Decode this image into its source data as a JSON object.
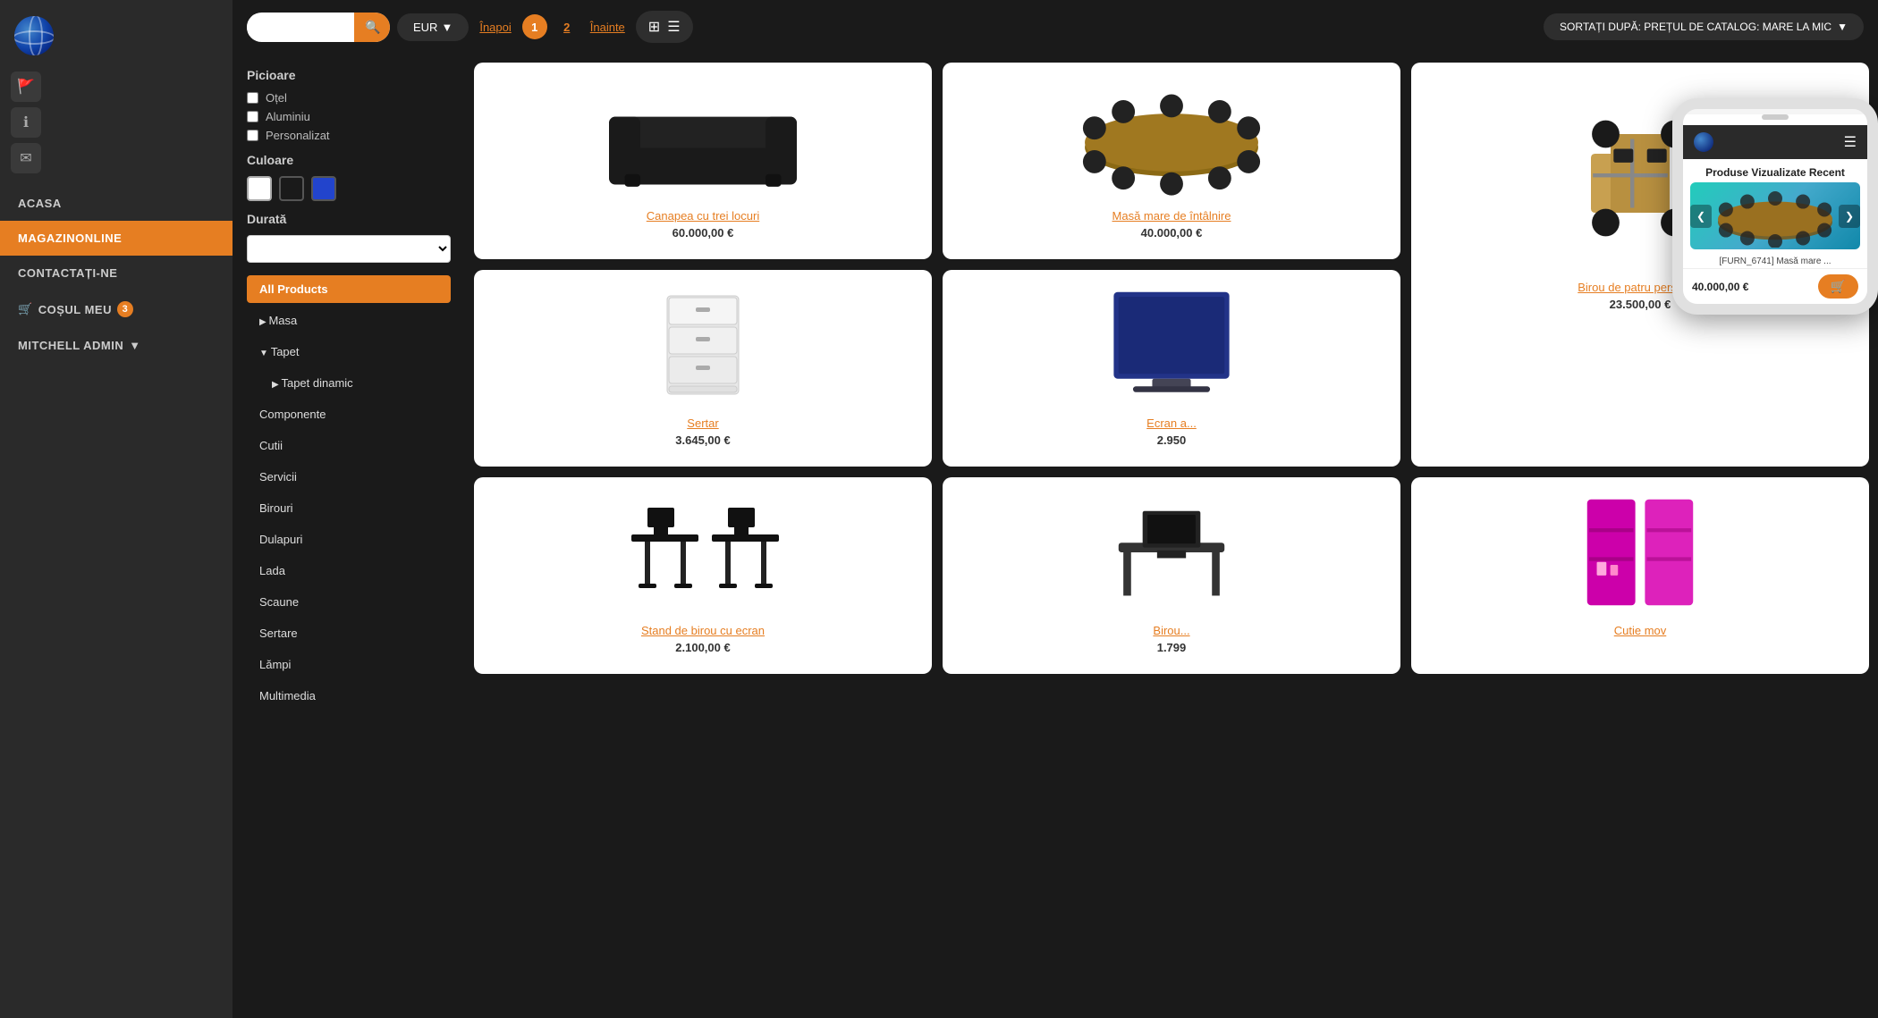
{
  "sidebar": {
    "logo_alt": "Globe Logo",
    "nav_items": [
      {
        "id": "acasa",
        "label": "ACASA",
        "active": false
      },
      {
        "id": "magazin",
        "label": "MAGAZINONLINE",
        "active": true
      },
      {
        "id": "contact",
        "label": "CONTACTAȚI-NE",
        "active": false
      },
      {
        "id": "cos",
        "label": "COȘUL MEU",
        "active": false,
        "cart": true,
        "badge": "3"
      },
      {
        "id": "admin",
        "label": "MITCHELL ADMIN",
        "active": false,
        "admin": true
      }
    ]
  },
  "toolbar": {
    "search_placeholder": "",
    "search_icon": "🔍",
    "currency_label": "EUR",
    "currency_arrow": "▼",
    "nav_back": "Înapoi",
    "page1": "1",
    "page2": "2",
    "nav_forward": "Înainte",
    "view_grid_icon": "⊞",
    "view_list_icon": "☰",
    "sort_label": "SORTAȚI DUPĂ: PREȚUL DE CATALOG: MARE LA MIC",
    "sort_arrow": "▼"
  },
  "filters": {
    "picioare_title": "Picioare",
    "picioare_options": [
      "Oțel",
      "Aluminiu",
      "Personalizat"
    ],
    "culoare_title": "Culoare",
    "colors": [
      {
        "name": "white",
        "hex": "#ffffff"
      },
      {
        "name": "black",
        "hex": "#1a1a1a"
      },
      {
        "name": "blue",
        "hex": "#2244cc"
      }
    ],
    "durata_title": "Durată",
    "durata_placeholder": "",
    "categories": [
      {
        "id": "all",
        "label": "All Products",
        "active": true
      },
      {
        "id": "masa",
        "label": "Masa",
        "arrow": "right"
      },
      {
        "id": "tapet",
        "label": "Tapet",
        "arrow": "down"
      },
      {
        "id": "tapet-dinamic",
        "label": "Tapet dinamic",
        "arrow": "right",
        "sub": true
      },
      {
        "id": "componente",
        "label": "Componente"
      },
      {
        "id": "cutii",
        "label": "Cutii"
      },
      {
        "id": "servicii",
        "label": "Servicii"
      },
      {
        "id": "birouri",
        "label": "Birouri"
      },
      {
        "id": "dulapuri",
        "label": "Dulapuri"
      },
      {
        "id": "lada",
        "label": "Lada"
      },
      {
        "id": "scaune",
        "label": "Scaune"
      },
      {
        "id": "sertare",
        "label": "Sertare"
      },
      {
        "id": "lampi",
        "label": "Lămpi"
      },
      {
        "id": "multimedia",
        "label": "Multimedia"
      }
    ]
  },
  "products": [
    {
      "id": "canapea",
      "name": "Canapea cu trei locuri",
      "price": "60.000,00 €",
      "color": "#222",
      "shape": "sofa"
    },
    {
      "id": "masa-intalnire",
      "name": "Masă mare de întâlnire",
      "price": "40.000,00 €",
      "color": "#8B6914",
      "shape": "conference-table"
    },
    {
      "id": "birou-4",
      "name": "Birou de patru persoane",
      "price": "23.500,00 €",
      "color": "#8B6914",
      "shape": "office-cluster"
    },
    {
      "id": "sertar",
      "name": "Sertar",
      "price": "3.645,00 €",
      "color": "#eee",
      "shape": "drawer"
    },
    {
      "id": "ecran",
      "name": "Ecran a...",
      "price": "2.950",
      "color": "#223388",
      "shape": "screen"
    },
    {
      "id": "stand-birou",
      "name": "Stand de birou cu ecran",
      "price": "2.100,00 €",
      "color": "#111",
      "shape": "standing-desk"
    },
    {
      "id": "birou2",
      "name": "Birou...",
      "price": "1.799",
      "color": "#333",
      "shape": "desk"
    },
    {
      "id": "cutie-mov",
      "name": "Cutie mov",
      "price": "",
      "color": "#aa00aa",
      "shape": "box"
    }
  ],
  "mobile_preview": {
    "title": "Produse Vizualizate Recent",
    "product_code": "[FURN_6741] Masă mare ...",
    "price": "40.000,00 €",
    "cart_icon": "🛒",
    "prev_icon": "❮",
    "next_icon": "❯"
  }
}
